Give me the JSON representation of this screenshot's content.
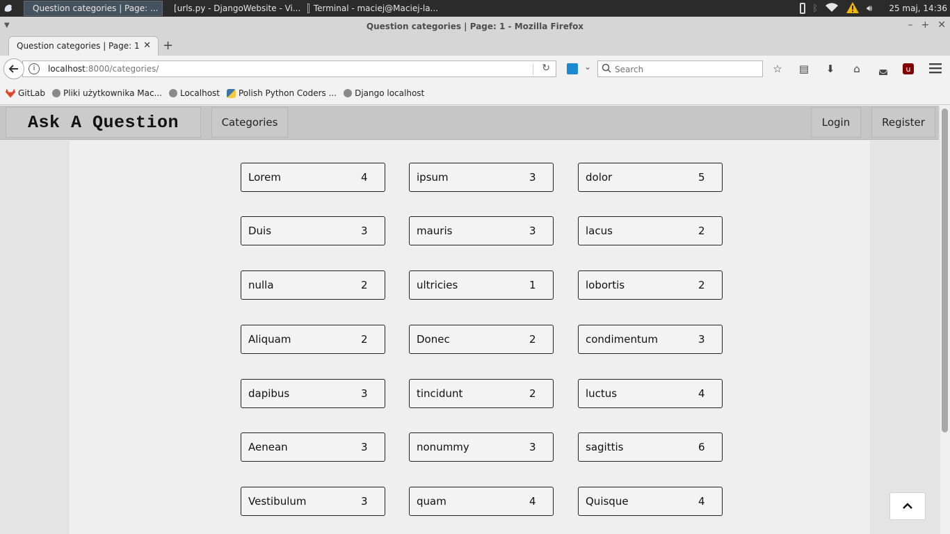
{
  "taskbar": {
    "tasks": [
      {
        "label": "Question categories | Page: ..."
      },
      {
        "label": "[urls.py - DjangoWebsite - Vi..."
      },
      {
        "label": "Terminal - maciej@Maciej-la..."
      }
    ],
    "clock": "25 maj, 14:36"
  },
  "window": {
    "title": "Question categories | Page: 1 - Mozilla Firefox"
  },
  "browser": {
    "tab_title": "Question categories | Page: 1",
    "url_host": "localhost",
    "url_rest": ":8000/categories/",
    "search_placeholder": "Search",
    "bookmarks": [
      "GitLab",
      "Pliki użytkownika Mac...",
      "Localhost",
      "Polish Python Coders ...",
      "Django localhost"
    ]
  },
  "site": {
    "brand": "Ask A Question",
    "nav_categories": "Categories",
    "nav_login": "Login",
    "nav_register": "Register"
  },
  "categories": [
    {
      "name": "Lorem",
      "count": "4"
    },
    {
      "name": "ipsum",
      "count": "3"
    },
    {
      "name": "dolor",
      "count": "5"
    },
    {
      "name": "Duis",
      "count": "3"
    },
    {
      "name": "mauris",
      "count": "3"
    },
    {
      "name": "lacus",
      "count": "2"
    },
    {
      "name": "nulla",
      "count": "2"
    },
    {
      "name": "ultricies",
      "count": "1"
    },
    {
      "name": "lobortis",
      "count": "2"
    },
    {
      "name": "Aliquam",
      "count": "2"
    },
    {
      "name": "Donec",
      "count": "2"
    },
    {
      "name": "condimentum",
      "count": "3"
    },
    {
      "name": "dapibus",
      "count": "3"
    },
    {
      "name": "tincidunt",
      "count": "2"
    },
    {
      "name": "luctus",
      "count": "4"
    },
    {
      "name": "Aenean",
      "count": "3"
    },
    {
      "name": "nonummy",
      "count": "3"
    },
    {
      "name": "sagittis",
      "count": "6"
    },
    {
      "name": "Vestibulum",
      "count": "3"
    },
    {
      "name": "quam",
      "count": "4"
    },
    {
      "name": "Quisque",
      "count": "4"
    }
  ]
}
